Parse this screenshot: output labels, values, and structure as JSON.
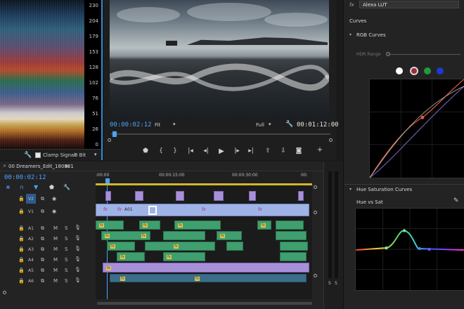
{
  "scope": {
    "ticks": [
      "230",
      "204",
      "179",
      "153",
      "128",
      "102",
      "76",
      "51",
      "26",
      "0"
    ],
    "clamp_label": "Clamp Signal",
    "bit_label": "8 Bit"
  },
  "monitor": {
    "timecode_current": "00:00:02:12",
    "fit_label": "Fit",
    "quality_label": "Full",
    "timecode_total": "00:01:12:00"
  },
  "timeline": {
    "sequence_name": "00 Dreamers_Edit_180831",
    "timecode": "00:00:02:12",
    "ruler": [
      ":00:00",
      "00:00:15:00",
      "00:00:30:00",
      "00:"
    ],
    "tracks": [
      "V2",
      "V1",
      "A1",
      "A2",
      "A3",
      "A4",
      "A5",
      "A6"
    ],
    "clip_label_a01": "A01",
    "fx_label": "fx",
    "fx_badge": "fx"
  },
  "meters": {
    "solo_labels": [
      "S",
      "S"
    ]
  },
  "lumetri": {
    "fx_label": "fx",
    "effect": "Alexa LUT",
    "section_curves": "Curves",
    "rgb_curves": "RGB Curves",
    "hdr_range": "HDR Range",
    "hue_sat_curves": "Hue Saturation Curves",
    "hue_vs_sat": "Hue vs Sat"
  },
  "colors": {
    "accent": "#2d8ad8",
    "timecode": "#4aa3ff",
    "video_clip": "#9fb3e6",
    "audio_clip": "#3f9f6e"
  }
}
